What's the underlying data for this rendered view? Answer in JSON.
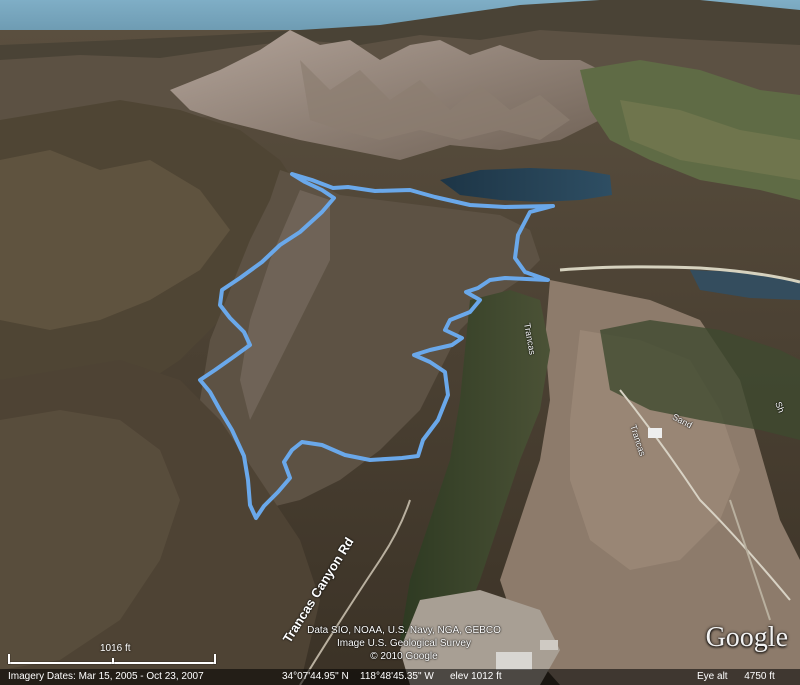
{
  "map": {
    "roads": [
      {
        "id": "trancas-1",
        "label": "Trancas Canyon Rd"
      },
      {
        "id": "trancas-2",
        "label": "Trancas"
      },
      {
        "id": "trancas-3",
        "label": "Trancas"
      },
      {
        "id": "trancas-4",
        "label": "Sand"
      },
      {
        "id": "trancas-5",
        "label": "Sh"
      }
    ],
    "credits": {
      "line1": "Data SIO, NOAA, U.S. Navy, NGA, GEBCO",
      "line2": "Image U.S. Geological Survey",
      "line3": "© 2010 Google"
    },
    "logo": "Google",
    "scale": "1016 ft",
    "track_color": "#6aa8ea"
  },
  "status": {
    "imagery_dates": "Imagery Dates: Mar 15, 2005 - Oct 23, 2007",
    "lat": "34°07'44.95\" N",
    "lon": "118°48'45.35\" W",
    "elev": "elev 1012 ft",
    "eye_alt_label": "Eye alt",
    "eye_alt_value": "4750 ft"
  }
}
